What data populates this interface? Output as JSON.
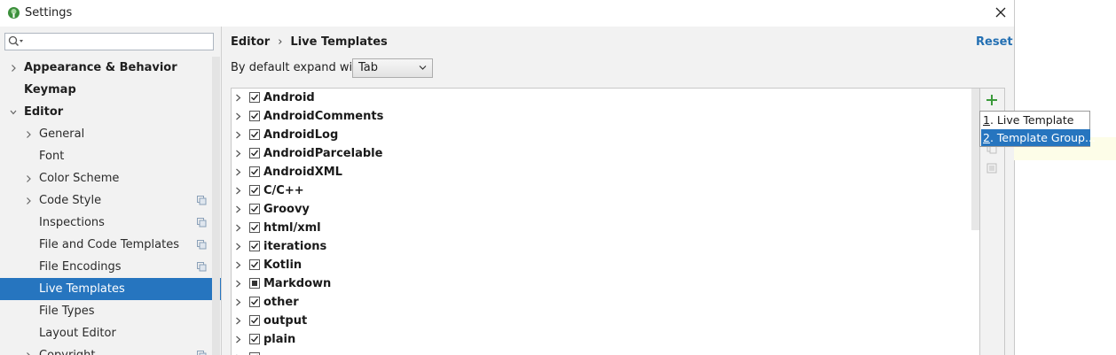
{
  "window": {
    "title": "Settings",
    "app_icon": "android-studio-icon",
    "close_icon": "close-icon"
  },
  "sidebar": {
    "search": {
      "value": "",
      "placeholder": "",
      "icon": "search-icon"
    },
    "items": [
      {
        "label": "Appearance & Behavior",
        "level": 0,
        "expandable": true,
        "expanded": false
      },
      {
        "label": "Keymap",
        "level": 0,
        "expandable": false
      },
      {
        "label": "Editor",
        "level": 0,
        "expandable": true,
        "expanded": true
      },
      {
        "label": "General",
        "level": 1,
        "expandable": true,
        "expanded": false
      },
      {
        "label": "Font",
        "level": 1,
        "expandable": false
      },
      {
        "label": "Color Scheme",
        "level": 1,
        "expandable": true,
        "expanded": false
      },
      {
        "label": "Code Style",
        "level": 1,
        "expandable": true,
        "expanded": false,
        "project_icon": true
      },
      {
        "label": "Inspections",
        "level": 1,
        "expandable": false,
        "project_icon": true
      },
      {
        "label": "File and Code Templates",
        "level": 1,
        "expandable": false,
        "project_icon": true
      },
      {
        "label": "File Encodings",
        "level": 1,
        "expandable": false,
        "project_icon": true
      },
      {
        "label": "Live Templates",
        "level": 1,
        "expandable": false,
        "selected": true
      },
      {
        "label": "File Types",
        "level": 1,
        "expandable": false
      },
      {
        "label": "Layout Editor",
        "level": 1,
        "expandable": false
      },
      {
        "label": "Copyright",
        "level": 1,
        "expandable": true,
        "expanded": false,
        "project_icon": true
      }
    ]
  },
  "main": {
    "breadcrumb": {
      "parent": "Editor",
      "separator": "›",
      "current": "Live Templates"
    },
    "reset_label": "Reset",
    "expand_label": "By default expand with",
    "expand_value": "Tab",
    "groups": [
      {
        "name": "Android",
        "state": "checked"
      },
      {
        "name": "AndroidComments",
        "state": "checked"
      },
      {
        "name": "AndroidLog",
        "state": "checked"
      },
      {
        "name": "AndroidParcelable",
        "state": "checked"
      },
      {
        "name": "AndroidXML",
        "state": "checked"
      },
      {
        "name": "C/C++",
        "state": "checked"
      },
      {
        "name": "Groovy",
        "state": "checked"
      },
      {
        "name": "html/xml",
        "state": "checked"
      },
      {
        "name": "iterations",
        "state": "checked"
      },
      {
        "name": "Kotlin",
        "state": "checked"
      },
      {
        "name": "Markdown",
        "state": "partial"
      },
      {
        "name": "other",
        "state": "checked"
      },
      {
        "name": "output",
        "state": "checked"
      },
      {
        "name": "plain",
        "state": "checked"
      },
      {
        "name": "",
        "state": "checked"
      }
    ],
    "toolbar": {
      "add_icon": "plus-icon",
      "copy_icon": "copy-icon",
      "edit_icon": "edit-icon"
    }
  },
  "popup": {
    "items": [
      {
        "mnemonic": "1",
        "label": ". Live Template"
      },
      {
        "mnemonic": "2",
        "label": ". Template Group..."
      }
    ]
  },
  "colors": {
    "selection": "#2675bf",
    "link": "#2470b3",
    "add": "#3b9a3b",
    "background": "#f2f2f2"
  }
}
